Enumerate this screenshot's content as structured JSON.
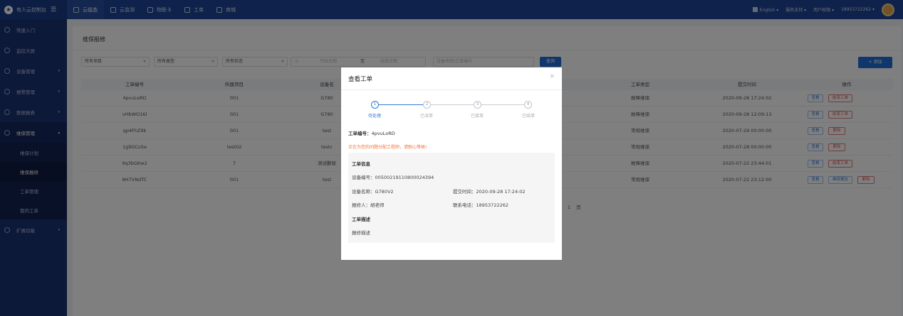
{
  "app": {
    "title": "有人云控制台",
    "logo_glyph": "★",
    "menu_icon": "☰"
  },
  "topnav": [
    {
      "label": "云组态",
      "active": true
    },
    {
      "label": "云监测",
      "active": false
    },
    {
      "label": "物联卡",
      "active": false
    },
    {
      "label": "工单",
      "active": false
    },
    {
      "label": "商城",
      "active": false
    }
  ],
  "topright": {
    "language": "English",
    "support": "服务支持",
    "permissions": "用户权限",
    "phone": "18953722262"
  },
  "sidebar": [
    {
      "label": "快速入门",
      "caret": ""
    },
    {
      "label": "监控大屏",
      "caret": ""
    },
    {
      "label": "设备管理",
      "caret": "▾"
    },
    {
      "label": "报警管理",
      "caret": "▾"
    },
    {
      "label": "数据报表",
      "caret": "▾"
    },
    {
      "label": "维保管理",
      "caret": "▴",
      "open": true
    }
  ],
  "sidebar_sub": [
    {
      "label": "维保计划",
      "active": false
    },
    {
      "label": "维保报修",
      "active": true
    },
    {
      "label": "工单管理",
      "active": false
    },
    {
      "label": "我的工单",
      "active": false
    }
  ],
  "sidebar_extra": {
    "label": "扩展功能",
    "caret": "▾"
  },
  "page": {
    "title": "维保报修",
    "filters": {
      "project": "所有项目",
      "type": "所有类型",
      "status": "所有状态",
      "start_date": "开始日期",
      "to": "至",
      "end_date": "结束日期",
      "search_placeholder": "设备名称/工单编号",
      "query_btn": "查询",
      "add_btn": "+ 添加"
    },
    "table": {
      "headers": [
        "工单编号",
        "所属项目",
        "设备名",
        "工单类型",
        "提交时间",
        "操作"
      ],
      "rows": [
        {
          "id": "4pvuLoRD",
          "project": "001",
          "device": "G780",
          "type": "故障维保",
          "time": "2020-09-28 17:24:02",
          "actions": [
            "查看",
            "结束工单"
          ]
        },
        {
          "id": "vHbWO16l",
          "project": "001",
          "device": "G780",
          "type": "故障维保",
          "time": "2020-09-28 12:09:13",
          "actions": [
            "查看",
            "结束工单"
          ]
        },
        {
          "id": "qp4FhZ9k",
          "project": "001",
          "device": "test",
          "type": "常规维保",
          "time": "2020-07-29 00:00:00",
          "actions": [
            "查看",
            "删除"
          ]
        },
        {
          "id": "1g9GCo5e",
          "project": "test02",
          "device": "testc",
          "type": "常规维保",
          "time": "2020-07-28 00:00:00",
          "actions": [
            "查看",
            "删除"
          ]
        },
        {
          "id": "9q3bGKw2",
          "project": "7",
          "device": "测试删除",
          "type": "故障维保",
          "time": "2020-07-22 23:44:01",
          "actions": [
            "查看",
            "结束工单"
          ]
        },
        {
          "id": "8H7VNdTC",
          "project": "001",
          "device": "test",
          "type": "常规维保",
          "time": "2020-07-22 23:12:00",
          "actions": [
            "查看",
            "维保报告",
            "删除"
          ]
        }
      ]
    },
    "pager": {
      "page": "1",
      "unit": "页"
    }
  },
  "modal": {
    "title": "查看工单",
    "close": "×",
    "steps": [
      {
        "num": "1",
        "label": "待处理",
        "active": true
      },
      {
        "num": "2",
        "label": "已派单",
        "active": false
      },
      {
        "num": "3",
        "label": "已接单",
        "active": false
      },
      {
        "num": "4",
        "label": "已结单",
        "active": false
      }
    ],
    "order_label": "工单编号：",
    "order_no": "4pvuLoRD",
    "notice": "正在为您的问题分配工程师，请耐心等候!",
    "info_title": "工单信息",
    "device_no_label": "设备编号：",
    "device_no": "00500219110800024394",
    "device_name_label": "设备名称：",
    "device_name": "G780V2",
    "submit_time_label": "提交时间：",
    "submit_time": "2020-09-28 17:24:02",
    "reporter_label": "报修人：",
    "reporter": "胡老师",
    "phone_label": "联系电话：",
    "phone": "18953722262",
    "desc_title": "工单描述",
    "desc": "报修描述"
  }
}
